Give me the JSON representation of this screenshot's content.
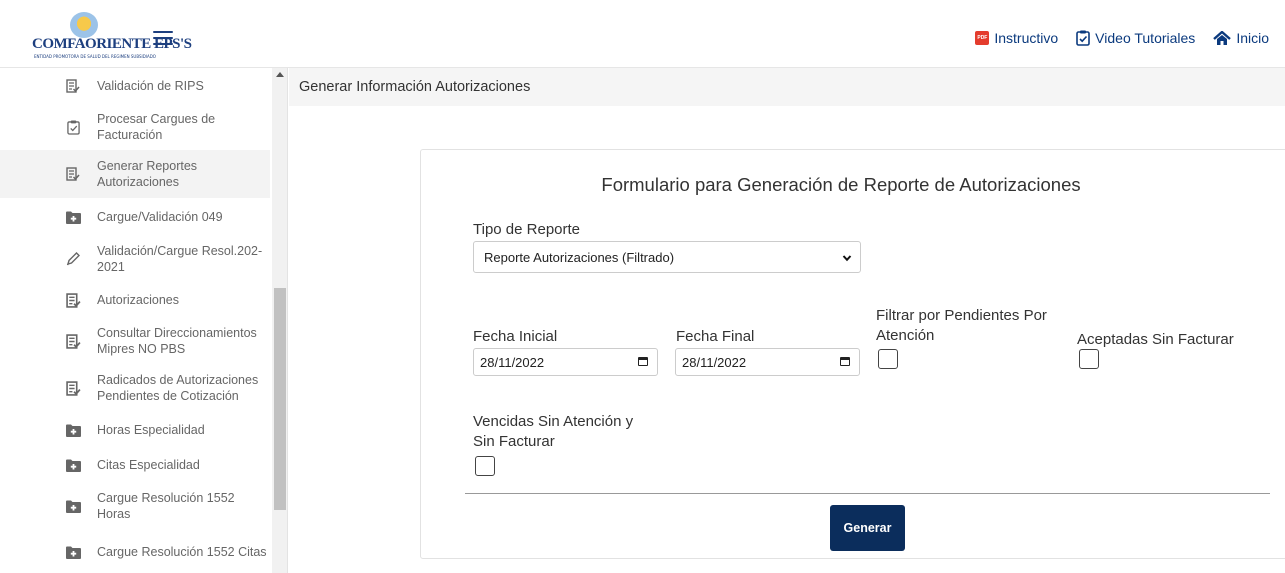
{
  "header": {
    "logo_text": "COMFAORIENTE EPS'S",
    "logo_subtext": "ENTIDAD PROMOTORA DE SALUD DEL REGIMEN SUBSIDIADO",
    "links": [
      {
        "label": "Instructivo",
        "icon": "pdf-icon"
      },
      {
        "label": "Video Tutoriales",
        "icon": "clipboard-check-icon"
      },
      {
        "label": "Inicio",
        "icon": "home-icon"
      }
    ]
  },
  "sidebar": {
    "items": [
      {
        "label": "Validación de RIPS",
        "icon": "checklist-icon"
      },
      {
        "label": "Procesar Cargues de Facturación",
        "icon": "clipboard-check-icon"
      },
      {
        "label": "Generar Reportes Autorizaciones",
        "icon": "checklist-icon"
      },
      {
        "label": "Cargue/Validación 049",
        "icon": "folder-plus-icon"
      },
      {
        "label": "Validación/Cargue Resol.202-2021",
        "icon": "pencil-icon"
      },
      {
        "label": "Autorizaciones",
        "icon": "checklist-icon"
      },
      {
        "label": "Consultar Direccionamientos Mipres NO PBS",
        "icon": "checklist-icon"
      },
      {
        "label": "Radicados de Autorizaciones Pendientes de Cotización",
        "icon": "checklist-icon"
      },
      {
        "label": "Horas Especialidad",
        "icon": "folder-plus-icon"
      },
      {
        "label": "Citas Especialidad",
        "icon": "folder-plus-icon"
      },
      {
        "label": "Cargue Resolución 1552 Horas",
        "icon": "folder-plus-icon"
      },
      {
        "label": "Cargue Resolución 1552 Citas",
        "icon": "folder-plus-icon"
      }
    ]
  },
  "main": {
    "breadcrumb": "Generar Información Autorizaciones",
    "form": {
      "title": "Formulario para Generación de Reporte de Autorizaciones",
      "tipo_reporte_label": "Tipo de Reporte",
      "tipo_reporte_value": "Reporte Autorizaciones (Filtrado)",
      "fecha_inicial_label": "Fecha Inicial",
      "fecha_inicial_value": "28/11/2022",
      "fecha_final_label": "Fecha Final",
      "fecha_final_value": "28/11/2022",
      "filtrar_label": "Filtrar por Pendientes Por Atención",
      "aceptadas_label": "Aceptadas Sin Facturar",
      "vencidas_label": "Vencidas Sin Atención y Sin Facturar",
      "generar_label": "Generar"
    }
  },
  "colors": {
    "brand": "#1d3f7f",
    "button": "#0b2d5c",
    "link": "#0b3a7e"
  }
}
